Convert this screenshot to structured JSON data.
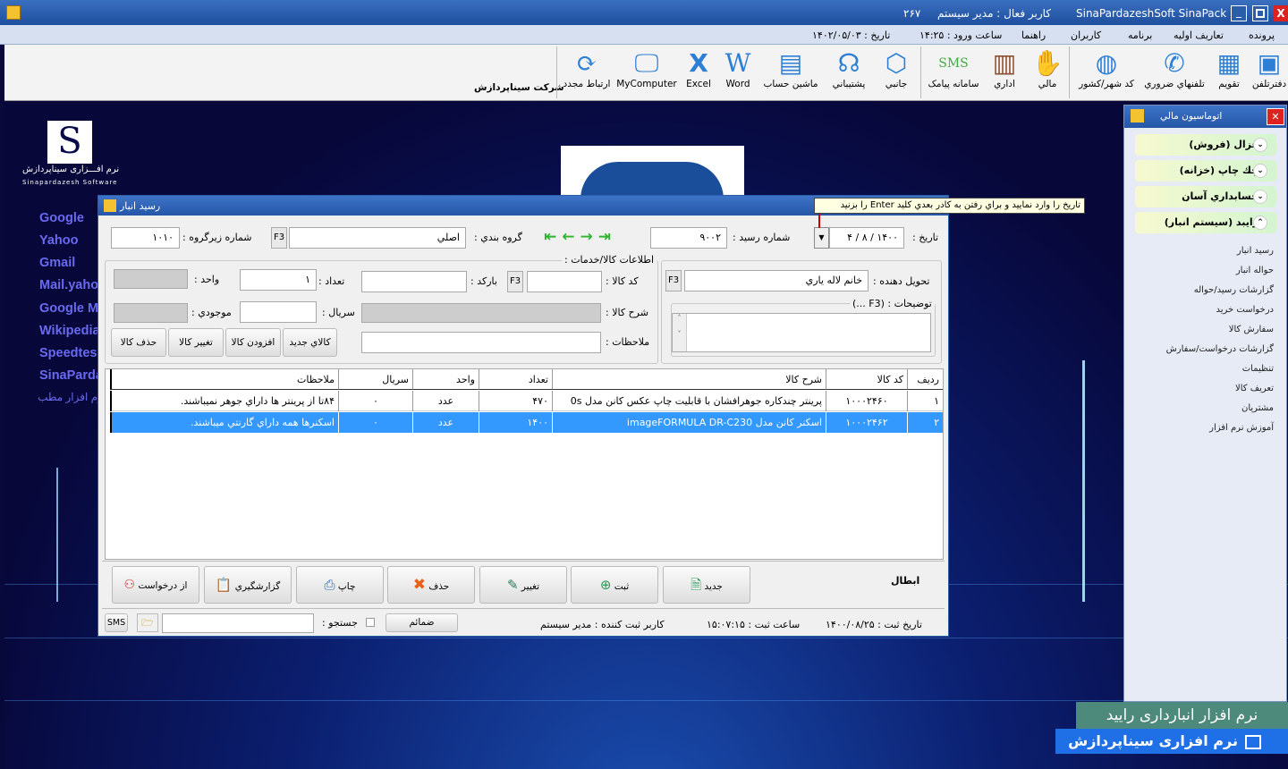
{
  "window": {
    "app_title": "SinaPardazeshSoft SinaPack",
    "active_user": "كاربر فعال : مدير سيستم",
    "code": "۲۶۷"
  },
  "menu": {
    "items": [
      "پرونده",
      "تعاريف اوليه",
      "برنامه",
      "كاربران",
      "راهنما"
    ],
    "login_time": "ساعت ورود : ۱۴:۲۵",
    "date": "تاريخ : ۱۴۰۲/۰۵/۰۳"
  },
  "toolbar": {
    "company": "شرکت سيناپردازش",
    "buttons": [
      {
        "label": "دفترتلفن",
        "icon": "contact-book-icon"
      },
      {
        "label": "تقويم",
        "icon": "calendar-icon"
      },
      {
        "label": "تلفنهاي ضروري",
        "icon": "phone-icon"
      },
      {
        "label": "کد شهر/کشور",
        "icon": "globe-icon"
      },
      {
        "label": "مالي",
        "icon": "money-hand-icon"
      },
      {
        "label": "اداري",
        "icon": "building-icon"
      },
      {
        "label": "سامانه پيامک",
        "icon": "sms-icon"
      },
      {
        "label": "جانبي",
        "icon": "box-icon"
      },
      {
        "label": "پشتيباني",
        "icon": "headset-icon"
      },
      {
        "label": "ماشين حساب",
        "icon": "calculator-icon"
      },
      {
        "label": "Word",
        "icon": "word-icon"
      },
      {
        "label": "Excel",
        "icon": "excel-icon"
      },
      {
        "label": "MyComputer",
        "icon": "monitor-icon"
      },
      {
        "label": "ارتباط مجدد",
        "icon": "refresh-icon"
      }
    ]
  },
  "desktop": {
    "logo_text": "نرم افـــزاری سیناپردازش",
    "logo_sub": "Sinapardazesh Software",
    "links": [
      "Google",
      "Yahoo",
      "Gmail",
      "Mail.yahoo",
      "Google M",
      "Wikipedia",
      "Speedtes",
      "SinaParda",
      "نرم افزار مطب"
    ],
    "banner1": "نرم افزار انبارداری رایید",
    "banner2": "نرم افزاری سیناپردازش"
  },
  "tooltip": "تاريخ را وارد نماييد و براي رفتن به کادر بعدي کليد Enter را بزنيد",
  "dialog": {
    "title": "رسيد انبار",
    "date_label": "تاريخ :",
    "date_value": "۱۴۰۰ / ۸ / ۴",
    "receipt_label": "شماره رسيد :",
    "receipt_value": "۹۰۰۲",
    "group_label": "گروه بندي :",
    "group_value": "اصلي",
    "subgroup_label": "شماره زيرگروه :",
    "subgroup_value": "۱۰۱۰",
    "f3": "F3",
    "deliverer_label": "تحويل دهنده :",
    "deliverer_value": "خانم لاله ياري",
    "notes_label": "توضيحات : (F3 ...)",
    "goods_group": "اطلاعات کالا/خدمات :",
    "code_label": "کد کالا :",
    "barcode_label": "بارکد :",
    "qty_label": "تعداد :",
    "qty_value": "۱",
    "unit_label": "واحد :",
    "desc_label": "شرح کالا :",
    "serial_label": "سريال :",
    "stock_label": "موجودي :",
    "remarks_label": "ملاحظات :",
    "item_buttons": [
      "كالاي جديد",
      "افزودن کالا",
      "تغيير کالا",
      "حذف کالا"
    ],
    "table": {
      "headers": [
        "رديف",
        "کد کالا",
        "شرح کالا",
        "تعداد",
        "واحد",
        "سريال",
        "ملاحظات"
      ],
      "rows": [
        [
          "۱",
          "۱۰۰۰۲۴۶۰",
          "پرينتر چندکاره جوهرافشان با قابليت چاپ عکس کانن مدل 0s",
          "۴۷۰",
          "عدد",
          "۰",
          "۸۴تا از پرينتر ها داراي جوهر نميباشند."
        ],
        [
          "۲",
          "۱۰۰۰۲۴۶۲",
          "اسکنر کانن مدل imageFORMULA DR-C230",
          "۱۴۰۰",
          "عدد",
          "۰",
          "اسکنرها همه داراي گارنتي ميباشند."
        ]
      ],
      "selected_row": 2
    },
    "cancel_label": "ابطال",
    "actions": [
      {
        "label": "جديد",
        "icon": "new-doc-icon"
      },
      {
        "label": "ثبت",
        "icon": "plus-circle-icon"
      },
      {
        "label": "تغيير",
        "icon": "edit-icon"
      },
      {
        "label": "حذف",
        "icon": "delete-icon"
      },
      {
        "label": "چاپ",
        "icon": "printer-icon"
      },
      {
        "label": "گزارشگيري",
        "icon": "report-icon"
      },
      {
        "label": "از درخواست",
        "icon": "request-icon"
      }
    ],
    "status": {
      "reg_date": "تاريخ ثبت : ۱۴۰۰/۰۸/۲۵",
      "reg_time": "ساعت ثبت : ۱۵:۰۷:۱۵",
      "reg_user": "كاربر ثبت كننده : مدير سيستم",
      "attachments": "ضمائم",
      "search_label": "جستجو :",
      "sms": "SMS"
    }
  },
  "panel": {
    "title": "اتوماسيون مالي",
    "sections": [
      "غزال (فروش)",
      "چك چاپ (خزانه)",
      "حسابداري آسان",
      "رايبد (سيستم انبار)"
    ],
    "items": [
      "رسيد انبار",
      "حواله انبار",
      "گزارشات رسيد/حواله",
      "درخواست خريد",
      "سفارش كالا",
      "گزارشات درخواست/سفارش",
      "تنظيمات",
      "تعريف كالا",
      "مشتريان",
      "آموزش نرم افزار"
    ]
  }
}
